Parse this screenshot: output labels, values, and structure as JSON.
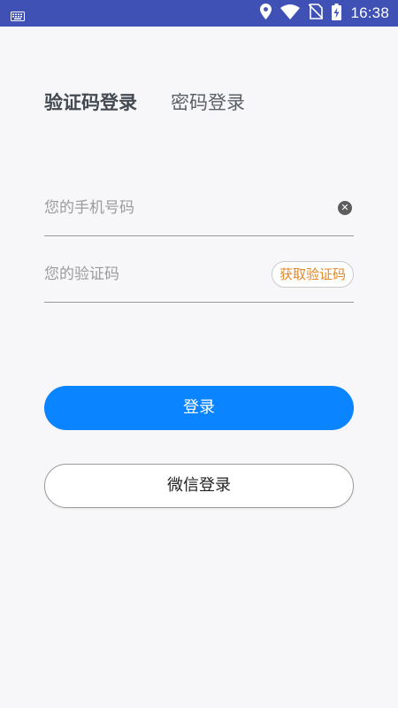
{
  "status_bar": {
    "time": "16:38",
    "icons": [
      "keyboard-icon",
      "location-icon",
      "wifi-icon",
      "no-sim-icon",
      "battery-charging-icon"
    ],
    "background": "#3f51b5"
  },
  "tabs": {
    "sms_login": "验证码登录",
    "password_login": "密码登录"
  },
  "phone_field": {
    "placeholder": "您的手机号码",
    "value": "",
    "clear_icon": "close-icon"
  },
  "code_field": {
    "placeholder": "您的验证码",
    "value": "",
    "get_code_label": "获取验证码"
  },
  "buttons": {
    "login_label": "登录",
    "wechat_login_label": "微信登录"
  },
  "colors": {
    "accent": "#0a84ff",
    "get_code_text": "#e2872a",
    "page_background": "#f7f7f9"
  }
}
